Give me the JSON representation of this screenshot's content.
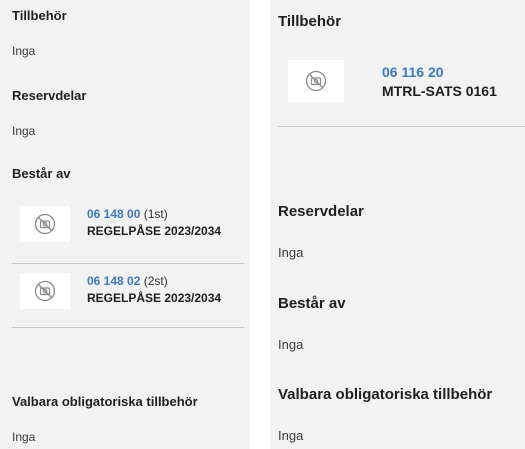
{
  "left": {
    "accessories": {
      "title": "Tillbehör",
      "value": "Inga"
    },
    "spare_parts": {
      "title": "Reservdelar",
      "value": "Inga"
    },
    "consists_of": {
      "title": "Består av",
      "items": [
        {
          "code": "06 148 00",
          "qty": "(1st)",
          "name": "REGELPÅSE 2023/2034",
          "icon": "no-image-icon"
        },
        {
          "code": "06 148 02",
          "qty": "(2st)",
          "name": "REGELPÅSE 2023/2034",
          "icon": "no-image-icon"
        }
      ]
    },
    "optional_mandatory": {
      "title": "Valbara obligatoriska tillbehör",
      "value": "Inga"
    }
  },
  "right": {
    "accessories": {
      "title": "Tillbehör",
      "items": [
        {
          "code": "06 116 20",
          "name": "MTRL-SATS 0161",
          "icon": "no-image-icon"
        }
      ]
    },
    "spare_parts": {
      "title": "Reservdelar",
      "value": "Inga"
    },
    "consists_of": {
      "title": "Består av",
      "value": "Inga"
    },
    "optional_mandatory": {
      "title": "Valbara obligatoriska tillbehör",
      "value": "Inga"
    }
  },
  "colors": {
    "link": "#3c78c8",
    "panel_bg": "#f2f2f2",
    "divider": "#c8c8c8"
  }
}
